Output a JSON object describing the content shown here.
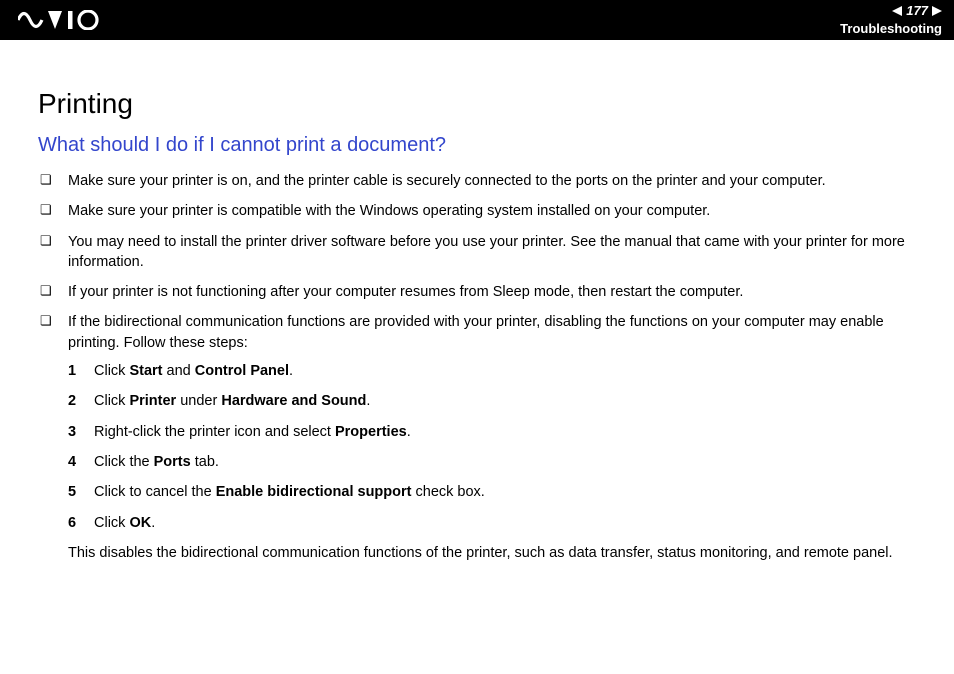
{
  "header": {
    "page_number": "177",
    "section": "Troubleshooting"
  },
  "title": "Printing",
  "question": "What should I do if I cannot print a document?",
  "bullets": [
    {
      "text": "Make sure your printer is on, and the printer cable is securely connected to the ports on the printer and your computer."
    },
    {
      "text": "Make sure your printer is compatible with the Windows operating system installed on your computer."
    },
    {
      "text": "You may need to install the printer driver software before you use your printer. See the manual that came with your printer for more information."
    },
    {
      "text": "If your printer is not functioning after your computer resumes from Sleep mode, then restart the computer."
    },
    {
      "text": "If the bidirectional communication functions are provided with your printer, disabling the functions on your computer may enable printing. Follow these steps:"
    }
  ],
  "steps": [
    {
      "pre": "Click ",
      "b1": "Start",
      "mid": " and ",
      "b2": "Control Panel",
      "post": "."
    },
    {
      "pre": "Click ",
      "b1": "Printer",
      "mid": " under ",
      "b2": "Hardware and Sound",
      "post": "."
    },
    {
      "pre": "Right-click the printer icon and select ",
      "b1": "Properties",
      "mid": "",
      "b2": "",
      "post": "."
    },
    {
      "pre": "Click the ",
      "b1": "Ports",
      "mid": "",
      "b2": "",
      "post": " tab."
    },
    {
      "pre": "Click to cancel the ",
      "b1": "Enable bidirectional support",
      "mid": "",
      "b2": "",
      "post": " check box."
    },
    {
      "pre": "Click ",
      "b1": "OK",
      "mid": "",
      "b2": "",
      "post": "."
    }
  ],
  "closing": "This disables the bidirectional communication functions of the printer, such as data transfer, status monitoring, and remote panel."
}
